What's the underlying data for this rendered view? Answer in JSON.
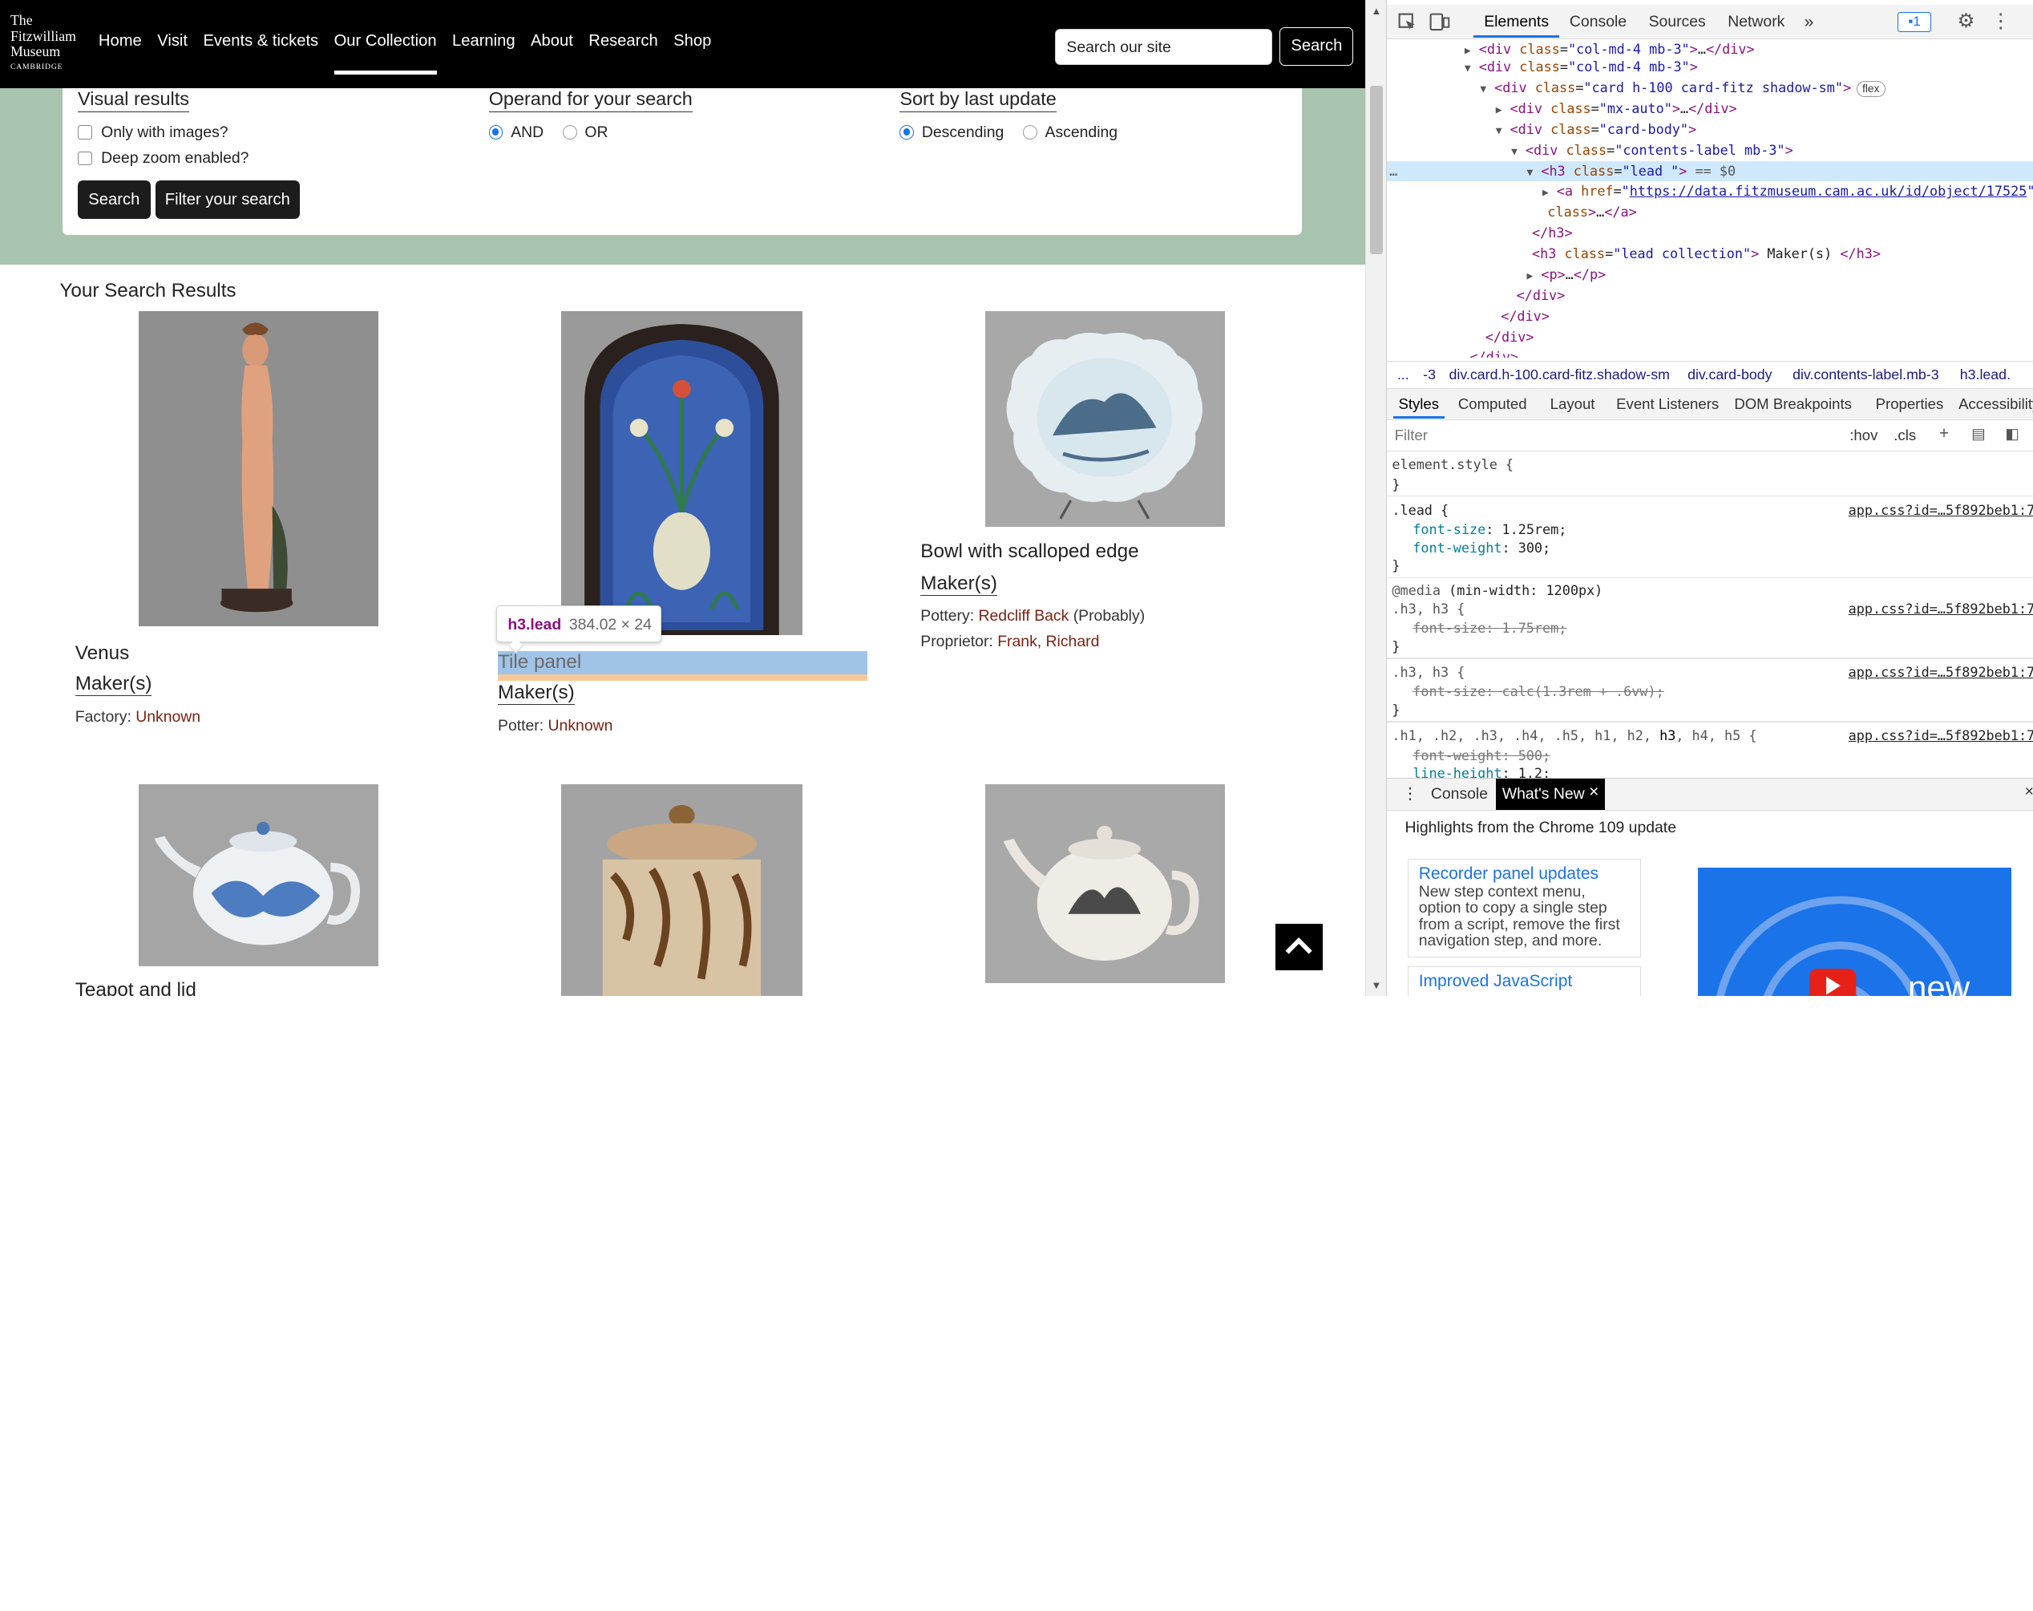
{
  "site": {
    "logo_line1": "The",
    "logo_line2": "Fitzwilliam",
    "logo_line3": "Museum",
    "logo_line4": "CAMBRIDGE",
    "nav": [
      "Home",
      "Visit",
      "Events & tickets",
      "Our Collection",
      "Learning",
      "About",
      "Research",
      "Shop"
    ],
    "search_placeholder": "Search our site",
    "search_button": "Search"
  },
  "filters": {
    "visual_title": "Visual results",
    "only_images": "Only with images?",
    "deep_zoom": "Deep zoom enabled?",
    "operand_title": "Operand for your search",
    "and_label": "AND",
    "or_label": "OR",
    "sort_title": "Sort by last update",
    "desc_label": "Descending",
    "asc_label": "Ascending",
    "search_button": "Search",
    "filter_button": "Filter your search"
  },
  "results": {
    "heading": "Your Search Results",
    "items": [
      {
        "title": "Venus",
        "maker": "Maker(s)",
        "role": "Factory: ",
        "person": "Unknown"
      },
      {
        "title": "Tile panel",
        "maker": "Maker(s)",
        "role": "Potter: ",
        "person": "Unknown"
      },
      {
        "title": "Bowl with scalloped edge",
        "maker": "Maker(s)",
        "role": "Pottery: ",
        "person": "Redcliff Back",
        "suffix": " (Probably)",
        "role2": "Proprietor: ",
        "person2": "Frank, Richard"
      },
      {
        "title": "Teapot and lid"
      }
    ]
  },
  "inspect_tooltip": {
    "tag": "h3.lead",
    "dims": "384.02 × 24"
  },
  "devtools": {
    "tabs": [
      "Elements",
      "Console",
      "Sources",
      "Network"
    ],
    "issues_count": "1",
    "tree": [
      {
        "indent": 0,
        "tri": "▶",
        "html": "<div class=\"col-md-4 mb-3\">…</div>"
      },
      {
        "indent": 0,
        "tri": "▼",
        "html": "<div class=\"col-md-4 mb-3\">"
      },
      {
        "indent": 1,
        "tri": "▼",
        "html": "<div class=\"card h-100 card-fitz shadow-sm\">"
      },
      {
        "indent": 2,
        "tri": "▶",
        "html": "<div class=\"mx-auto\">…</div>"
      },
      {
        "indent": 2,
        "tri": "▼",
        "html": "<div class=\"card-body\">"
      },
      {
        "indent": 3,
        "tri": "▼",
        "html": "<div class=\"contents-label mb-3\">"
      },
      {
        "indent": 4,
        "tri": "▼",
        "html": "<h3 class=\"lead \"> == $0"
      },
      {
        "indent": 5,
        "tri": "▶",
        "html": "<a href=\"https://data.fitzmuseum.cam.ac.uk/id/object/17525\""
      },
      {
        "indent": 5,
        "tri": "",
        "html": "class>…</a>"
      },
      {
        "indent": 4,
        "tri": "",
        "html": "</h3>"
      },
      {
        "indent": 4,
        "tri": "",
        "html": "<h3 class=\"lead collection\"> Maker(s) </h3>"
      },
      {
        "indent": 4,
        "tri": "▶",
        "html": "<p>…</p>"
      },
      {
        "indent": 3,
        "tri": "",
        "html": "</div>"
      },
      {
        "indent": 2,
        "tri": "",
        "html": "</div>"
      },
      {
        "indent": 1,
        "tri": "",
        "html": "</div>"
      },
      {
        "indent": 0,
        "tri": "",
        "html": "</div>"
      }
    ],
    "flex_badge": "flex",
    "breadcrumbs": [
      "...",
      "-3",
      "div.card.h-100.card-fitz.shadow-sm",
      "div.card-body",
      "div.contents-label.mb-3",
      "h3.lead."
    ],
    "subtabs": [
      "Styles",
      "Computed",
      "Layout",
      "Event Listeners",
      "DOM Breakpoints",
      "Properties",
      "Accessibility"
    ],
    "filter_placeholder": "Filter",
    "hov": ":hov",
    "cls": ".cls",
    "src_link": "app.css?id=…5f892beb1:7",
    "drawer_tabs": [
      "Console",
      "What's New"
    ],
    "highlights_title": "Highlights from the Chrome 109 update",
    "card1_title": "Recorder panel updates",
    "card1_body": "New step context menu, option to copy a single step from a script, remove the first navigation step, and more.",
    "card2_title": "Improved JavaScript",
    "promo_text": "new"
  }
}
